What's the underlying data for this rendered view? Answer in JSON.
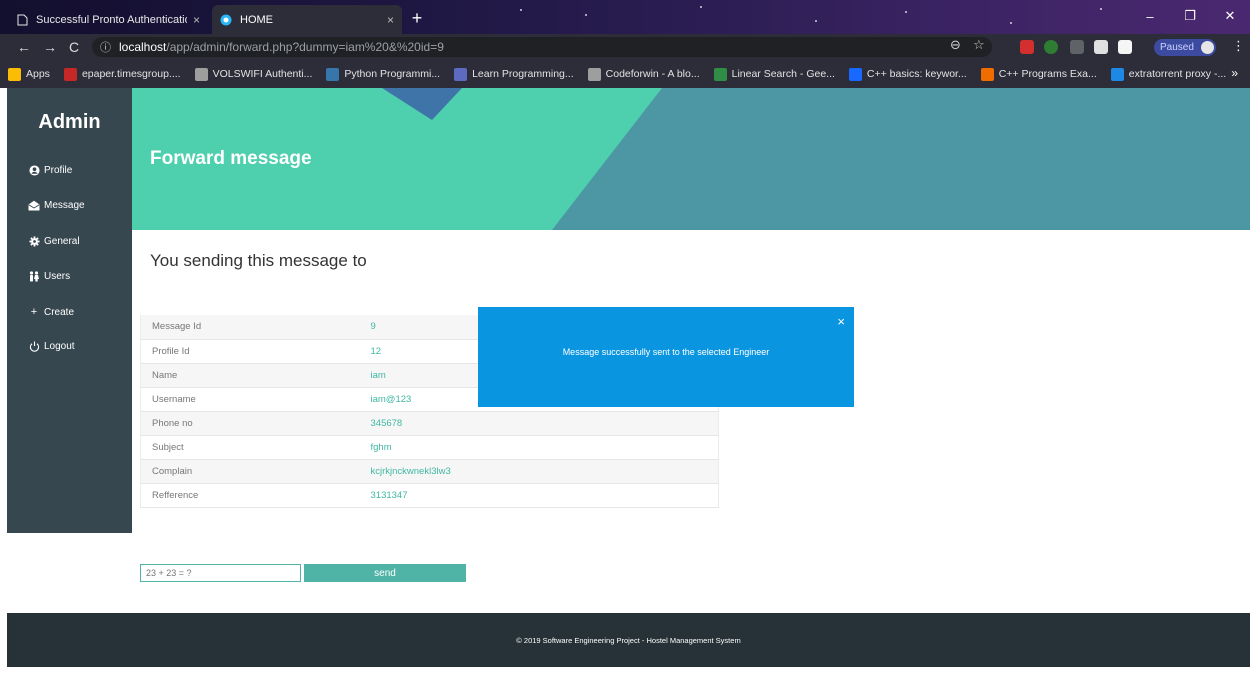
{
  "browser": {
    "tabs": [
      {
        "title": "Successful Pronto Authentication",
        "icon": "page-icon",
        "active": false
      },
      {
        "title": "HOME",
        "icon": "site-icon",
        "active": true
      }
    ],
    "url": {
      "host": "localhost",
      "path": "/app/admin/forward.php?dummy=iam%20&%20id=9"
    },
    "profile_status": "Paused",
    "bookmarks": [
      {
        "label": "Apps",
        "icon": "apps-grid-icon",
        "color": "#fbbc05"
      },
      {
        "label": "epaper.timesgroup....",
        "icon": "times-icon",
        "color": "#c62828"
      },
      {
        "label": "VOLSWIFI Authenti...",
        "icon": "page-icon",
        "color": "#9e9e9e"
      },
      {
        "label": "Python Programmi...",
        "icon": "python-icon",
        "color": "#3776ab"
      },
      {
        "label": "Learn Programming...",
        "icon": "book-icon",
        "color": "#5c6bc0"
      },
      {
        "label": "Codeforwin - A blo...",
        "icon": "page-icon",
        "color": "#9e9e9e"
      },
      {
        "label": "Linear Search - Gee...",
        "icon": "geeks-icon",
        "color": "#2f8d46"
      },
      {
        "label": "C++ basics: keywor...",
        "icon": "behance-icon",
        "color": "#1769ff"
      },
      {
        "label": "C++ Programs Exa...",
        "icon": "cpp-icon",
        "color": "#ef6c00"
      },
      {
        "label": "extratorrent proxy -...",
        "icon": "is-icon",
        "color": "#1e88e5"
      }
    ]
  },
  "sidebar": {
    "title": "Admin",
    "items": [
      {
        "label": "Profile",
        "icon": "user-circle-icon"
      },
      {
        "label": "Message",
        "icon": "envelope-open-icon"
      },
      {
        "label": "General",
        "icon": "gear-icon"
      },
      {
        "label": "Users",
        "icon": "users-icon"
      },
      {
        "label": "Create",
        "icon": "plus-icon"
      },
      {
        "label": "Logout",
        "icon": "power-icon"
      }
    ]
  },
  "hero": {
    "title": "Forward message"
  },
  "main": {
    "heading": "You sending this message to",
    "rows": [
      {
        "label": "Message Id",
        "value": "9"
      },
      {
        "label": "Profile Id",
        "value": "12"
      },
      {
        "label": "Name",
        "value": "iam"
      },
      {
        "label": "Username",
        "value": "iam@123"
      },
      {
        "label": "Phone no",
        "value": "345678"
      },
      {
        "label": "Subject",
        "value": "fghm"
      },
      {
        "label": "Complain",
        "value": "kcjrkjnckwnekl3lw3"
      },
      {
        "label": "Refference",
        "value": "3131347"
      }
    ],
    "captcha_placeholder": "23 + 23 = ?",
    "send_label": "send"
  },
  "alert": {
    "message": "Message successfully sent to the selected Engineer",
    "close": "×"
  },
  "footer": {
    "text": "© 2019 Software Engineering Project - Hostel Management System"
  },
  "colors": {
    "sidebar": "#37474f",
    "hero_teal": "#4ecfae",
    "hero_blue": "#4c97a3",
    "accent": "#4fb3a6",
    "alert": "#0a95e0",
    "footer": "#263238"
  }
}
